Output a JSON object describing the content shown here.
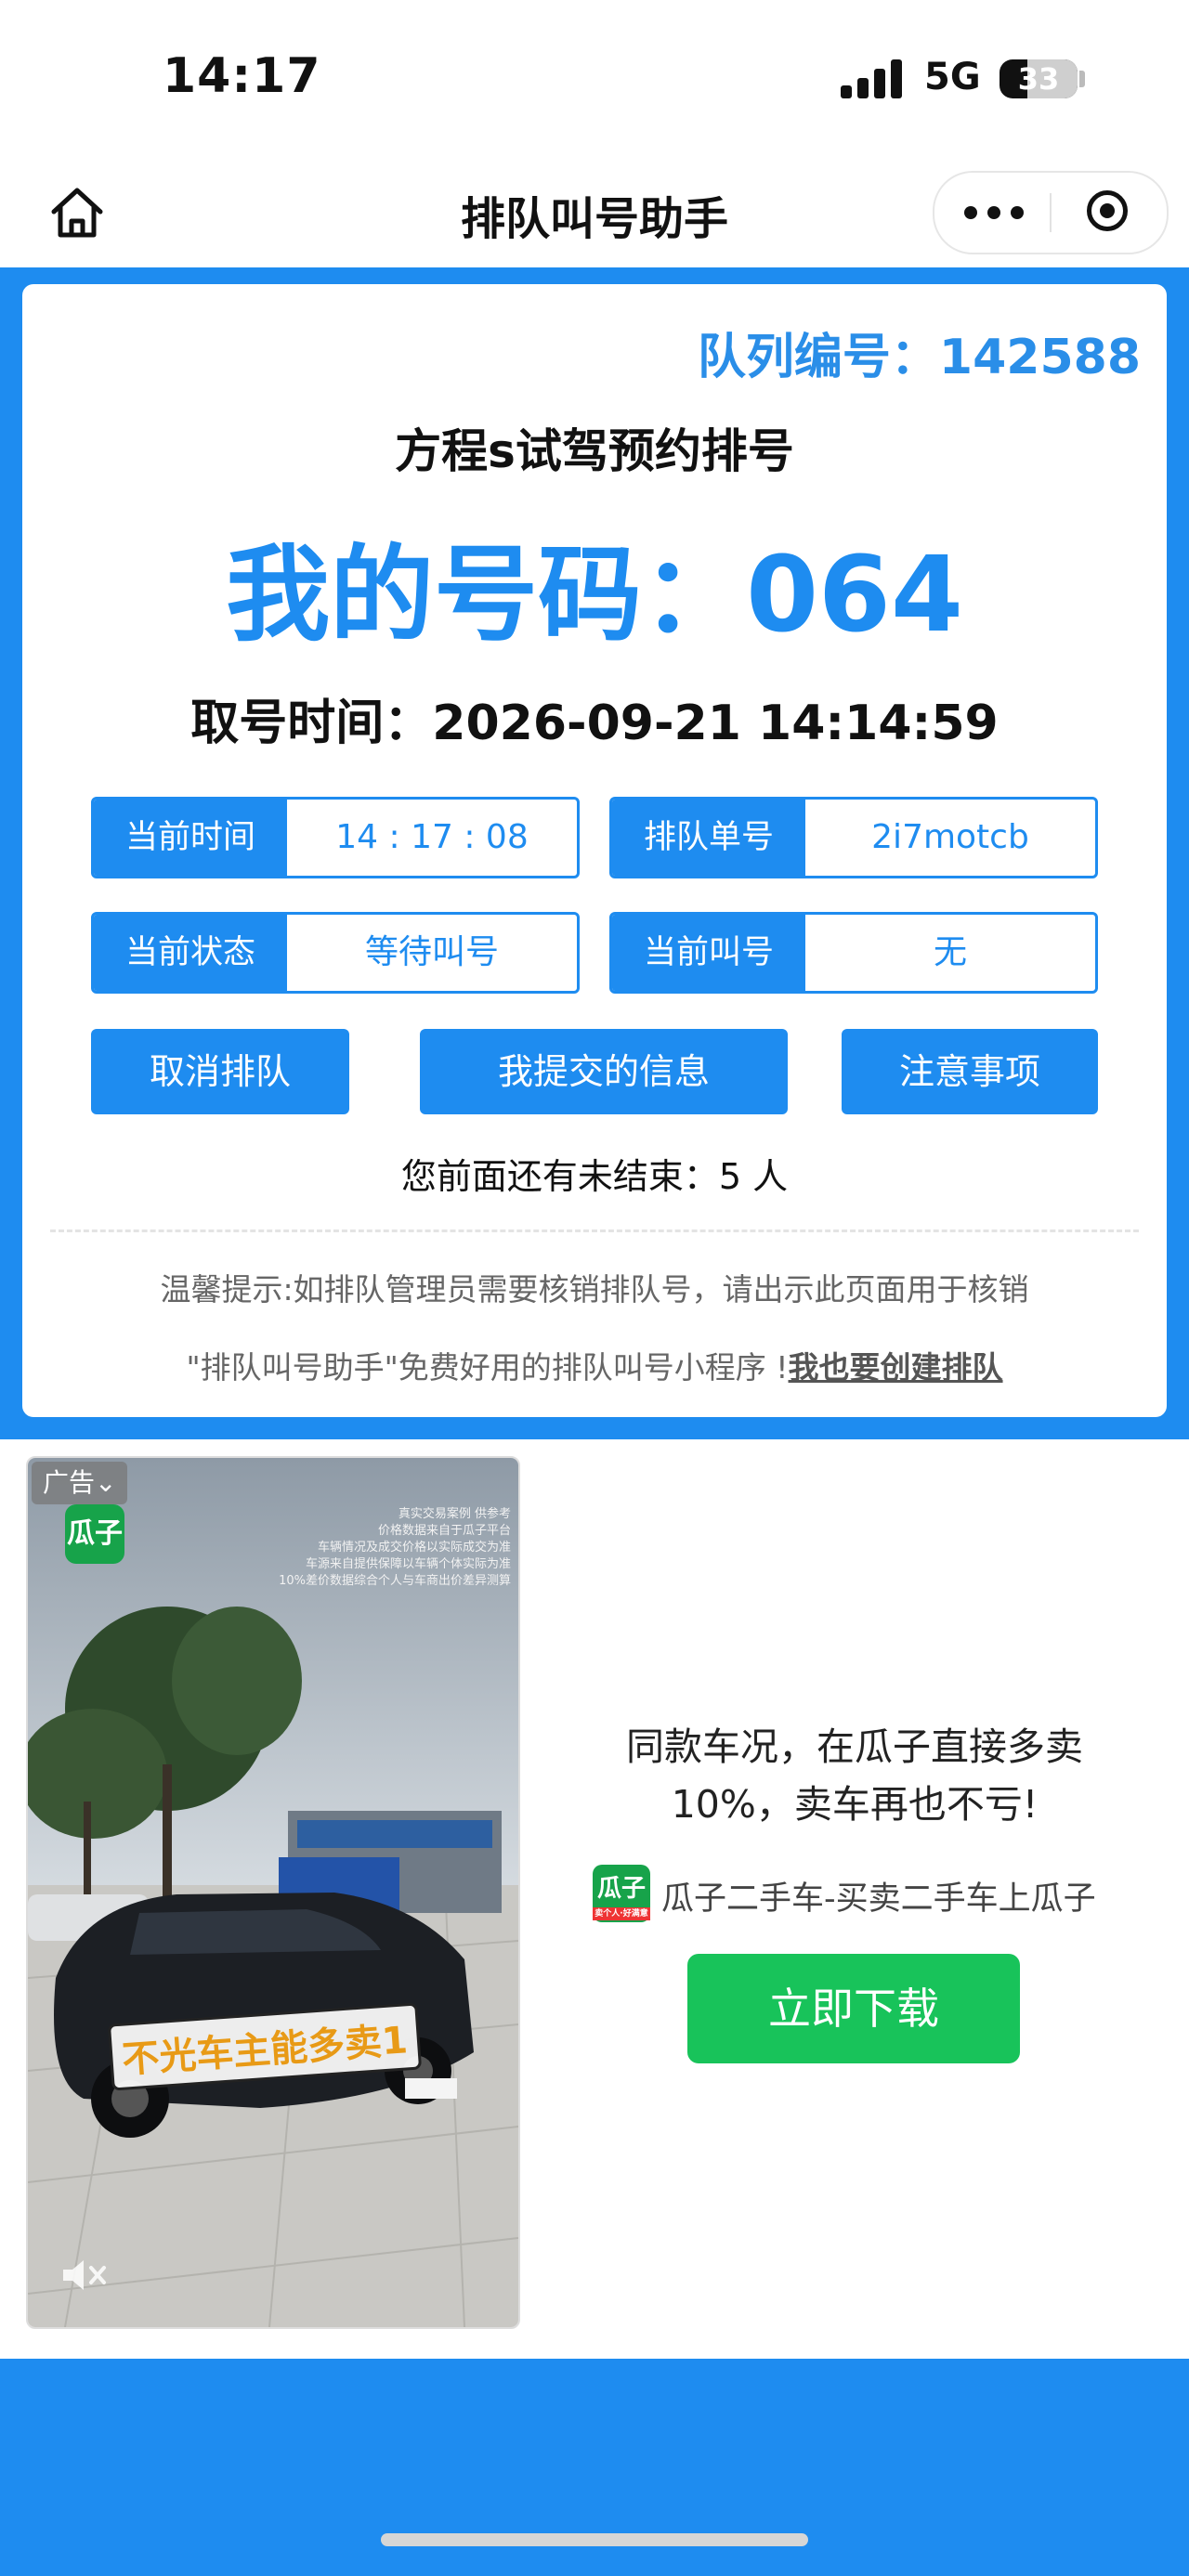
{
  "status_bar": {
    "time": "14:17",
    "network": "5G",
    "battery": "33"
  },
  "nav": {
    "title": "排队叫号助手",
    "home_icon": "home-icon",
    "more_icon": "more-dots-icon",
    "target_icon": "target-icon"
  },
  "card": {
    "queue_id": "队列编号：142588",
    "event_title": "方程s试驾预约排号",
    "my_number": "我的号码：064",
    "take_time": "取号时间：2026-09-21 14:14:59",
    "info": {
      "current_time_label": "当前时间",
      "current_time_value": "14 : 17 : 08",
      "order_label": "排队单号",
      "order_value": "2i7motcb",
      "status_label": "当前状态",
      "status_value": "等待叫号",
      "calling_label": "当前叫号",
      "calling_value": "无"
    },
    "buttons": {
      "cancel": "取消排队",
      "my_info": "我提交的信息",
      "notes": "注意事项"
    },
    "ahead_text": "您前面还有未结束：5 人",
    "tip": "温馨提示:如排队管理员需要核销排队号，请出示此页面用于核销",
    "promo_prefix": "\"排队叫号助手\"免费好用的排队叫号小程序 !",
    "promo_link": "我也要创建排队"
  },
  "ad": {
    "badge": "广告⌄",
    "logo_text": "瓜子",
    "overlay_lines": [
      "真实交易案例 供参考",
      "价格数据来自于瓜子平台",
      "车辆情况及成交价格以实际成交为准",
      "车源来自提供保障以车辆个体实际为准",
      "10%差价数据综合个人与车商出价差异测算"
    ],
    "car_caption": "不光车主能多卖1",
    "headline": "同款车况，在瓜子直接多卖10%，卖车再也不亏!",
    "advertiser_logo": "瓜子",
    "advertiser_logo_sub": "卖个人·好满意",
    "advertiser_name": "瓜子二手车-买卖二手车上瓜子",
    "download": "立即下载",
    "colors": {
      "brand_green": "#18c35a",
      "primary_blue": "#1e8cf0"
    }
  }
}
